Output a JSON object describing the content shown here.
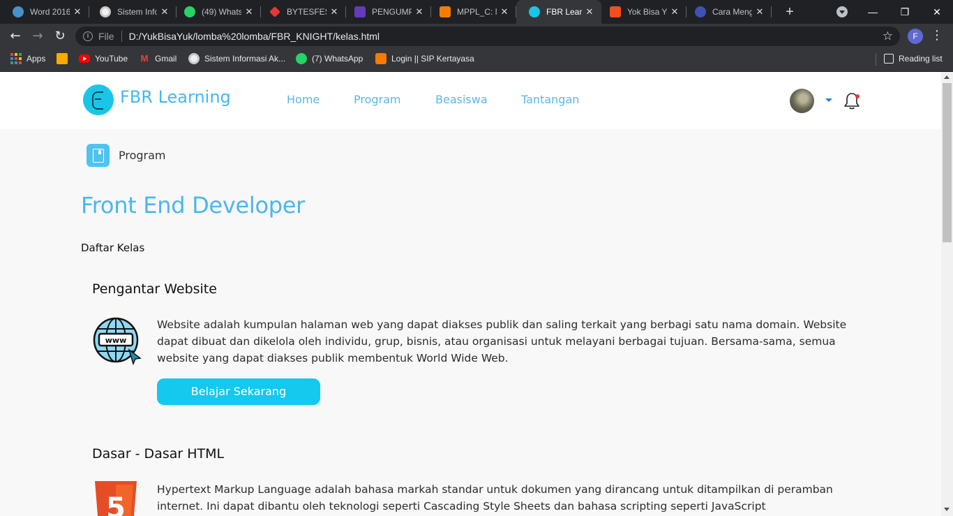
{
  "browser": {
    "tabs": [
      {
        "title": "Word 2016",
        "favicon_color": "#4a90c8"
      },
      {
        "title": "Sistem Info",
        "favicon_color": "#f1f1f1"
      },
      {
        "title": "(49) Whats",
        "favicon_color": "#25d366"
      },
      {
        "title": "BYTESFEST",
        "favicon_color": "#e53935"
      },
      {
        "title": "PENGUMP",
        "favicon_color": "#673ab7"
      },
      {
        "title": "MPPL_C: M",
        "favicon_color": "#f57c00"
      },
      {
        "title": "FBR Learnin",
        "favicon_color": "#19c6e8",
        "active": true
      },
      {
        "title": "Yok Bisa Yo",
        "favicon_color": "#f24e1e"
      },
      {
        "title": "Cara Meng",
        "favicon_color": "#3f51b5"
      }
    ],
    "close_glyph": "✕",
    "new_tab_glyph": "+",
    "window_controls": {
      "minimize": "—",
      "restore": "❐",
      "close": "✕"
    },
    "address": {
      "protocol": "File",
      "url": "D:/YukBisaYuk/lomba%20lomba/FBR_KNIGHT/kelas.html"
    },
    "profile_initial": "F",
    "bookmarks": [
      {
        "label": "Apps",
        "icon": "apps-grid-icon"
      },
      {
        "label": "",
        "icon": "classroom-icon"
      },
      {
        "label": "YouTube",
        "icon": "youtube-icon"
      },
      {
        "label": "Gmail",
        "icon": "gmail-icon"
      },
      {
        "label": "Sistem Informasi Ak...",
        "icon": "sia-icon"
      },
      {
        "label": "(7) WhatsApp",
        "icon": "whatsapp-icon"
      },
      {
        "label": "Login || SIP Kertayasa",
        "icon": "sip-icon"
      }
    ],
    "reading_list": "Reading list"
  },
  "site": {
    "brand": "FBR Learning",
    "nav": [
      "Home",
      "Program",
      "Beasiswa",
      "Tantangan"
    ],
    "breadcrumb": "Program",
    "page_title": "Front End Developer",
    "section_label": "Daftar Kelas",
    "courses": [
      {
        "title": "Pengantar Website",
        "description": "Website adalah kumpulan halaman web yang dapat diakses publik dan saling terkait yang berbagi satu nama domain. Website dapat dibuat dan dikelola oleh individu, grup, bisnis, atau organisasi untuk melayani berbagai tujuan. Bersama-sama, semua website yang dapat diakses publik membentuk World Wide Web.",
        "button": "Belajar Sekarang",
        "icon_text": "www"
      },
      {
        "title": "Dasar - Dasar HTML",
        "description": "Hypertext Markup Language adalah bahasa markah standar untuk dokumen yang dirancang untuk ditampilkan di peramban internet. Ini dapat dibantu oleh teknologi seperti Cascading Style Sheets dan bahasa scripting seperti JavaScript",
        "icon_text": "5"
      }
    ],
    "colors": {
      "brand": "#45b8ec",
      "button": "#14c8ee",
      "notification": "#e53935"
    }
  }
}
